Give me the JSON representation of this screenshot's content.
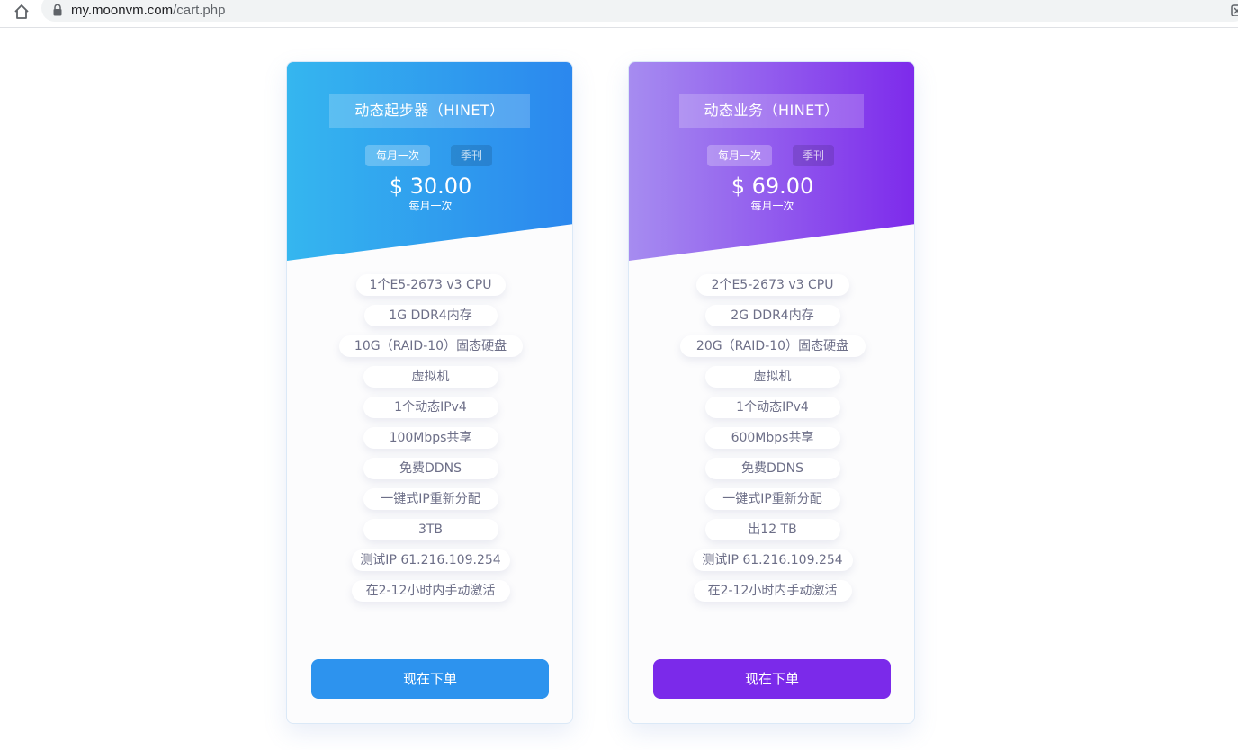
{
  "browser": {
    "url_host": "my.moonvm.com",
    "url_path": "/cart.php"
  },
  "plans": [
    {
      "title": "动态起步器（HINET）",
      "cycle_monthly": "每月一次",
      "cycle_quarterly": "季刊",
      "price": "$ 30.00",
      "price_period": "每月一次",
      "features": [
        "1个E5-2673 v3 CPU",
        "1G DDR4内存",
        "10G（RAID-10）固态硬盘",
        "虚拟机",
        "1个动态IPv4",
        "100Mbps共享",
        "免费DDNS",
        "一键式IP重新分配",
        "3TB",
        "测试IP 61.216.109.254",
        "在2-12小时内手动激活"
      ],
      "order_label": "现在下单",
      "accent": "#2d93ee"
    },
    {
      "title": "动态业务（HINET）",
      "cycle_monthly": "每月一次",
      "cycle_quarterly": "季刊",
      "price": "$ 69.00",
      "price_period": "每月一次",
      "features": [
        "2个E5-2673 v3 CPU",
        "2G DDR4内存",
        "20G（RAID-10）固态硬盘",
        "虚拟机",
        "1个动态IPv4",
        "600Mbps共享",
        "免费DDNS",
        "一键式IP重新分配",
        "出12 TB",
        "测试IP 61.216.109.254",
        "在2-12小时内手动激活"
      ],
      "order_label": "现在下单",
      "accent": "#7b2aea"
    }
  ]
}
